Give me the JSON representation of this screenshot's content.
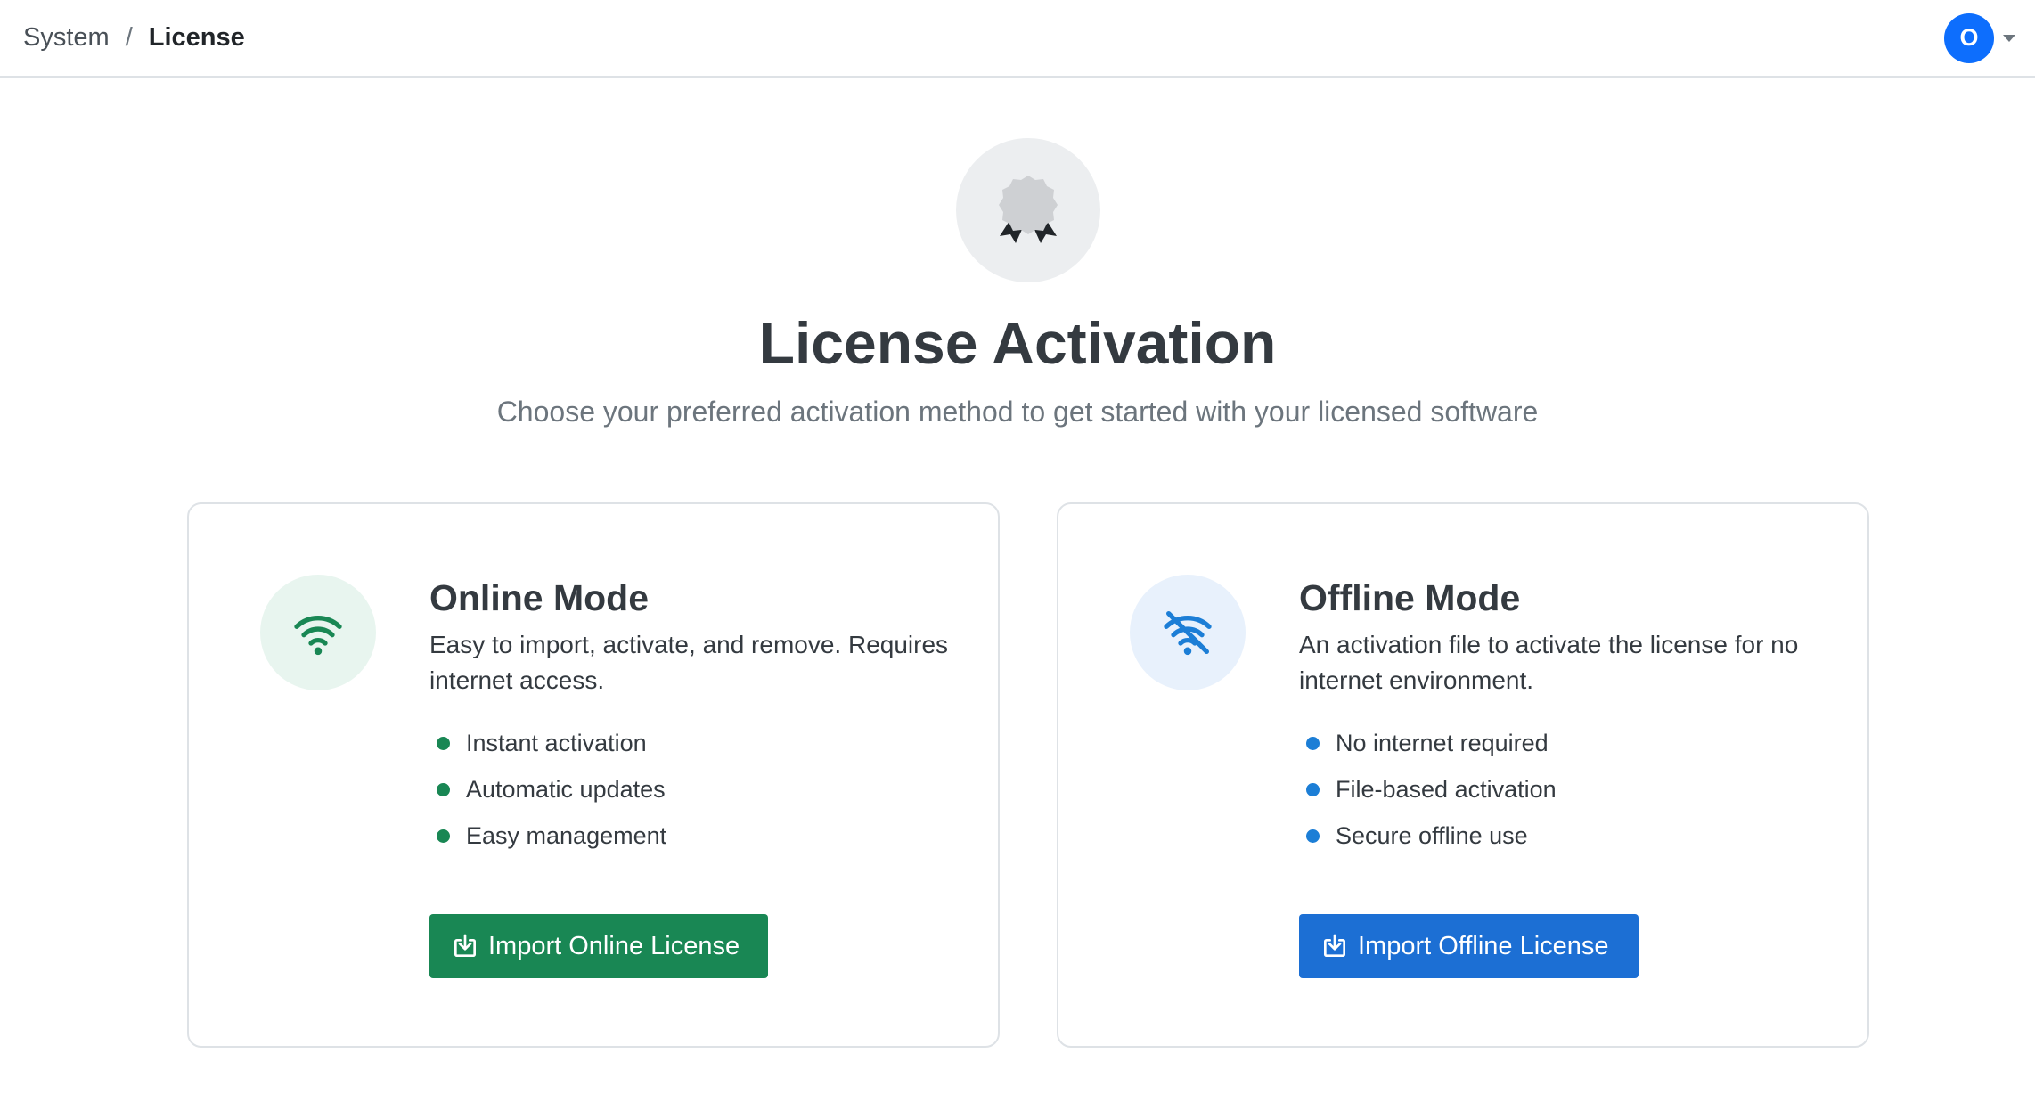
{
  "breadcrumb": {
    "items": [
      "System",
      "License"
    ],
    "separator": "/"
  },
  "user": {
    "initial": "O"
  },
  "hero": {
    "icon": "certificate-badge-icon",
    "title": "License Activation",
    "subtitle": "Choose your preferred activation method to get started with your licensed software"
  },
  "cards": [
    {
      "icon": "wifi-icon",
      "accent": "#198754",
      "title": "Online Mode",
      "description": "Easy to import, activate, and remove. Requires internet access.",
      "features": [
        "Instant activation",
        "Automatic updates",
        "Easy management"
      ],
      "button_label": "Import Online License",
      "button_icon": "download-icon"
    },
    {
      "icon": "wifi-off-icon",
      "accent": "#1c7ed6",
      "title": "Offline Mode",
      "description": "An activation file to activate the license for no internet environment.",
      "features": [
        "No internet required",
        "File-based activation",
        "Secure offline use"
      ],
      "button_label": "Import Offline License",
      "button_icon": "download-icon"
    }
  ]
}
